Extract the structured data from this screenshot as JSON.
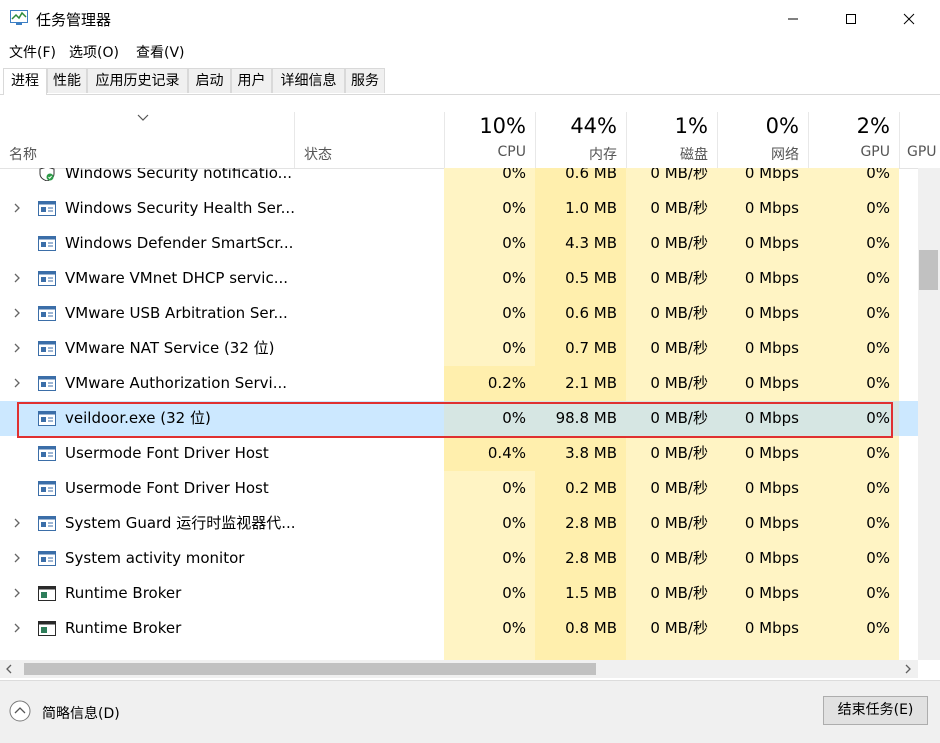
{
  "window": {
    "title": "任务管理器",
    "minimize_icon": "minimize-icon",
    "maximize_icon": "maximize-icon",
    "close_icon": "close-icon"
  },
  "menu": [
    "文件(F)",
    "选项(O)",
    "查看(V)"
  ],
  "tabs": [
    "进程",
    "性能",
    "应用历史记录",
    "启动",
    "用户",
    "详细信息",
    "服务"
  ],
  "header": {
    "name": "名称",
    "status": "状态",
    "cpu": {
      "pct": "10%",
      "label": "CPU"
    },
    "memory": {
      "pct": "44%",
      "label": "内存"
    },
    "disk": {
      "pct": "1%",
      "label": "磁盘"
    },
    "network": {
      "pct": "0%",
      "label": "网络"
    },
    "gpu": {
      "pct": "2%",
      "label": "GPU"
    },
    "gpu_engine": "GPU"
  },
  "rows": [
    {
      "name": "Windows Security notificatio...",
      "expandable": false,
      "icon": "shield-icon",
      "cpu": "0%",
      "mem": "0.6 MB",
      "disk": "0 MB/秒",
      "net": "0 Mbps",
      "gpu": "0%"
    },
    {
      "name": "Windows Security Health Ser...",
      "expandable": true,
      "icon": "service-icon",
      "cpu": "0%",
      "mem": "1.0 MB",
      "disk": "0 MB/秒",
      "net": "0 Mbps",
      "gpu": "0%"
    },
    {
      "name": "Windows Defender SmartScr...",
      "expandable": false,
      "icon": "service-icon",
      "cpu": "0%",
      "mem": "4.3 MB",
      "disk": "0 MB/秒",
      "net": "0 Mbps",
      "gpu": "0%"
    },
    {
      "name": "VMware VMnet DHCP servic...",
      "expandable": true,
      "icon": "service-icon",
      "cpu": "0%",
      "mem": "0.5 MB",
      "disk": "0 MB/秒",
      "net": "0 Mbps",
      "gpu": "0%"
    },
    {
      "name": "VMware USB Arbitration Ser...",
      "expandable": true,
      "icon": "service-icon",
      "cpu": "0%",
      "mem": "0.6 MB",
      "disk": "0 MB/秒",
      "net": "0 Mbps",
      "gpu": "0%"
    },
    {
      "name": "VMware NAT Service (32 位)",
      "expandable": true,
      "icon": "service-icon",
      "cpu": "0%",
      "mem": "0.7 MB",
      "disk": "0 MB/秒",
      "net": "0 Mbps",
      "gpu": "0%"
    },
    {
      "name": "VMware Authorization Servi...",
      "expandable": true,
      "icon": "service-icon",
      "cpu": "0.2%",
      "mem": "2.1 MB",
      "disk": "0 MB/秒",
      "net": "0 Mbps",
      "gpu": "0%"
    },
    {
      "name": "veildoor.exe (32 位)",
      "expandable": false,
      "icon": "service-icon",
      "cpu": "0%",
      "mem": "98.8 MB",
      "disk": "0 MB/秒",
      "net": "0 Mbps",
      "gpu": "0%",
      "selected": true
    },
    {
      "name": "Usermode Font Driver Host",
      "expandable": false,
      "icon": "service-icon",
      "cpu": "0.4%",
      "mem": "3.8 MB",
      "disk": "0 MB/秒",
      "net": "0 Mbps",
      "gpu": "0%"
    },
    {
      "name": "Usermode Font Driver Host",
      "expandable": false,
      "icon": "service-icon",
      "cpu": "0%",
      "mem": "0.2 MB",
      "disk": "0 MB/秒",
      "net": "0 Mbps",
      "gpu": "0%"
    },
    {
      "name": "System Guard 运行时监视器代...",
      "expandable": true,
      "icon": "service-icon",
      "cpu": "0%",
      "mem": "2.8 MB",
      "disk": "0 MB/秒",
      "net": "0 Mbps",
      "gpu": "0%"
    },
    {
      "name": "System activity monitor",
      "expandable": true,
      "icon": "service-icon",
      "cpu": "0%",
      "mem": "2.8 MB",
      "disk": "0 MB/秒",
      "net": "0 Mbps",
      "gpu": "0%"
    },
    {
      "name": "Runtime Broker",
      "expandable": true,
      "icon": "window-icon",
      "cpu": "0%",
      "mem": "1.5 MB",
      "disk": "0 MB/秒",
      "net": "0 Mbps",
      "gpu": "0%"
    },
    {
      "name": "Runtime Broker",
      "expandable": true,
      "icon": "window-icon",
      "cpu": "0%",
      "mem": "0.8 MB",
      "disk": "0 MB/秒",
      "net": "0 Mbps",
      "gpu": "0%"
    }
  ],
  "footer": {
    "collapse_label": "简略信息(D)",
    "end_task_label": "结束任务(E)"
  }
}
